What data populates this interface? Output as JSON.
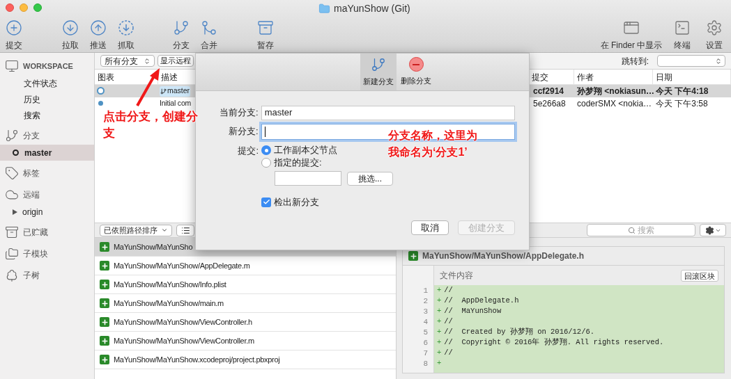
{
  "window": {
    "title": "maYunShow (Git)"
  },
  "toolbar": {
    "left": [
      {
        "label": "提交",
        "kind": "plus"
      },
      {
        "label": "拉取",
        "kind": "down"
      },
      {
        "label": "推送",
        "kind": "up"
      },
      {
        "label": "抓取",
        "kind": "fetch"
      },
      {
        "label": "分支",
        "kind": "branch"
      },
      {
        "label": "合并",
        "kind": "merge"
      },
      {
        "label": "暂存",
        "kind": "stash"
      }
    ],
    "right": [
      {
        "label": "在 Finder 中显示",
        "kind": "finder"
      },
      {
        "label": "终端",
        "kind": "terminal"
      },
      {
        "label": "设置",
        "kind": "settings"
      }
    ]
  },
  "sidebar": [
    {
      "title": "WORKSPACE",
      "kind": "workspace",
      "items": [
        {
          "label": "文件状态",
          "selected": false
        },
        {
          "label": "历史",
          "selected": false
        },
        {
          "label": "搜索",
          "selected": false
        }
      ]
    },
    {
      "title": "分支",
      "kind": "branch",
      "items": [
        {
          "label": "master",
          "selected": true
        }
      ]
    },
    {
      "title": "标签",
      "kind": "tag"
    },
    {
      "title": "远端",
      "kind": "cloud",
      "items": [
        {
          "label": "origin",
          "selected": false,
          "expanded": false
        }
      ]
    },
    {
      "title": "已贮藏",
      "kind": "stash"
    },
    {
      "title": "子模块",
      "kind": "folder"
    },
    {
      "title": "子树",
      "kind": "tree"
    }
  ],
  "filter_bar": {
    "branch_select": "所有分支",
    "remote_button": "显示远程",
    "jump_label": "跳转到:"
  },
  "commits": {
    "columns": [
      "图表",
      "描述",
      "提交",
      "作者",
      "日期"
    ],
    "rows": [
      {
        "branch": "master",
        "commit": "ccf2914",
        "author": "孙梦翔 <nokiasun…",
        "date": "今天 下午4:18",
        "selected": true
      },
      {
        "description": "Initial com",
        "commit": "5e266a8",
        "author": "coderSMX <nokia…",
        "date": "今天 下午3:58",
        "selected": false
      }
    ]
  },
  "files_bar": {
    "sort_select": "已依照路径排序"
  },
  "files": [
    {
      "path": "MaYunShow/MaYunSho",
      "selected": true
    },
    {
      "path": "MaYunShow/MaYunShow/AppDelegate.m",
      "selected": false
    },
    {
      "path": "MaYunShow/MaYunShow/Info.plist",
      "selected": false
    },
    {
      "path": "MaYunShow/MaYunShow/main.m",
      "selected": false
    },
    {
      "path": "MaYunShow/MaYunShow/ViewController.h",
      "selected": false
    },
    {
      "path": "MaYunShow/MaYunShow/ViewController.m",
      "selected": false
    },
    {
      "path": "MaYunShow/MaYunShow.xcodeproj/project.pbxproj",
      "selected": false
    }
  ],
  "diff": {
    "search_placeholder": "搜索",
    "file": "MaYunShow/MaYunShow/AppDelegate.h",
    "hunk_title": "文件内容",
    "hunk_button": "回滚区块",
    "lines": [
      {
        "number": "1",
        "marker": "+",
        "text": "//"
      },
      {
        "number": "2",
        "marker": "+",
        "text": "//  AppDelegate.h"
      },
      {
        "number": "3",
        "marker": "+",
        "text": "//  MaYunShow"
      },
      {
        "number": "4",
        "marker": "+",
        "text": "//"
      },
      {
        "number": "5",
        "marker": "+",
        "text": "//  Created by 孙梦翔 on 2016/12/6."
      },
      {
        "number": "6",
        "marker": "+",
        "text": "//  Copyright © 2016年 孙梦翔. All rights reserved."
      },
      {
        "number": "7",
        "marker": "+",
        "text": "//"
      },
      {
        "number": "8",
        "marker": "+"
      }
    ]
  },
  "dialog": {
    "tabs": [
      {
        "label": "新建分支",
        "kind": "branch",
        "selected": true
      },
      {
        "label": "删除分支",
        "kind": "delete",
        "selected": false
      }
    ],
    "current_label": "当前分支:",
    "current_value": "master",
    "new_label": "新分支:",
    "new_focused": true,
    "commit_label": "提交:",
    "radios": [
      {
        "label": "工作副本父节点",
        "selected": true
      },
      {
        "label": "指定的提交:",
        "selected": false
      }
    ],
    "pick_button": "挑选...",
    "checkout": {
      "label": "检出新分支",
      "checked": true
    },
    "buttons": [
      {
        "label": "取消",
        "disabled": false
      },
      {
        "label": "创建分支",
        "disabled": true
      }
    ]
  },
  "annotations": [
    "点击分支，创建分支",
    "分支名称，这里为我命名为‘分支1’"
  ]
}
